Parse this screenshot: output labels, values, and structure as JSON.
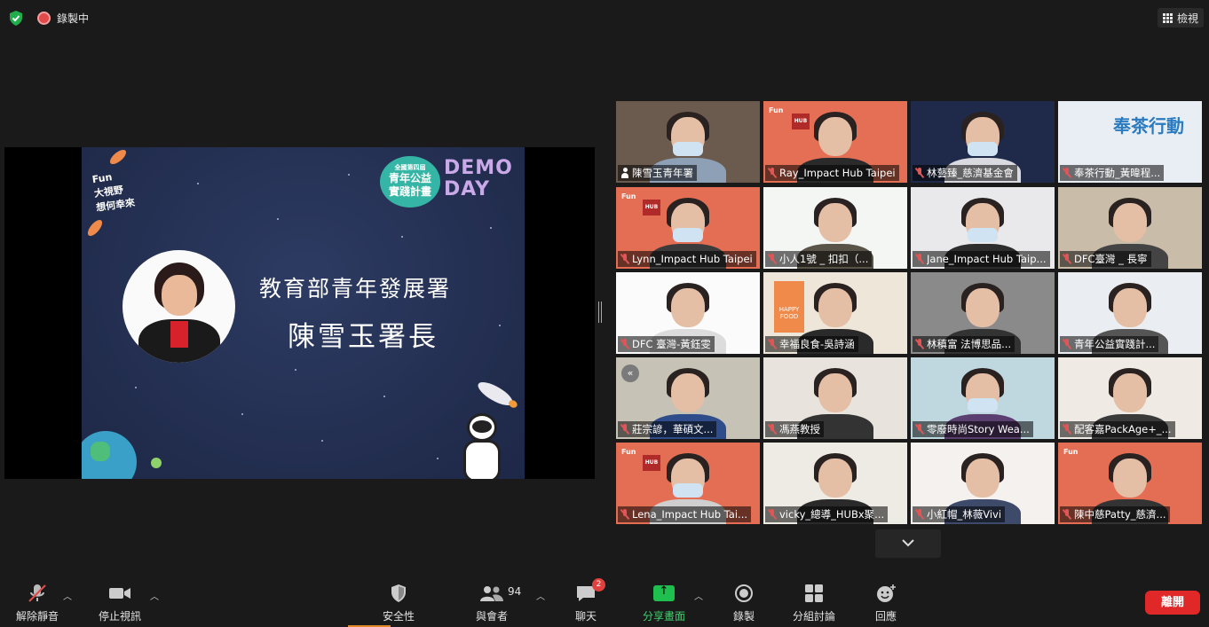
{
  "topbar": {
    "recording_label": "錄製中",
    "view_label": "檢視"
  },
  "colors": {
    "active_speaker_border": "#c8e34b",
    "leave_button": "#e02828",
    "share_green": "#1fbf4f",
    "recording_red": "#e04a4a",
    "security_green": "#1fae4b"
  },
  "shared_screen": {
    "title": "教育部青年發展署",
    "name": "陳雪玉署長",
    "badge_line1": "全國第四屆",
    "badge_line2": "青年公益",
    "badge_line3": "實踐計畫",
    "demo_line1": "DEMO",
    "demo_line2": "DAY",
    "fun_logo_line1": "Fun",
    "fun_logo_line2": "大視野",
    "fun_logo_line3": "想何幸來"
  },
  "participants": [
    {
      "name": "陳雪玉青年署",
      "icon": "pinned-person-icon",
      "active": true
    },
    {
      "name": "Ray_Impact Hub Taipei",
      "icon": "mic-off-icon"
    },
    {
      "name": "林藝臻_慈濟基金會",
      "icon": "mic-off-icon"
    },
    {
      "name": "奉茶行動_黃暐程...",
      "icon": "mic-off-icon"
    },
    {
      "name": "Lynn_Impact Hub Taipei",
      "icon": "mic-off-icon"
    },
    {
      "name": "小人1號 _ 扣扣（...",
      "icon": "mic-off-icon"
    },
    {
      "name": "Jane_Impact Hub Taip...",
      "icon": "mic-off-icon"
    },
    {
      "name": "DFC臺灣 _ 長寧",
      "icon": "mic-off-icon"
    },
    {
      "name": "DFC 臺灣-黃鈺雯",
      "icon": "mic-off-icon"
    },
    {
      "name": "幸福良食-吳詩涵",
      "icon": "mic-off-icon"
    },
    {
      "name": "林稹富 法博思品...",
      "icon": "mic-off-icon"
    },
    {
      "name": "青年公益實踐計...",
      "icon": "mic-off-icon"
    },
    {
      "name": "莊宗諺，華碩文...",
      "icon": "mic-off-icon"
    },
    {
      "name": "馮燕教授",
      "icon": "mic-off-icon"
    },
    {
      "name": "零廢時尚Story Wea...",
      "icon": "mic-off-icon"
    },
    {
      "name": "配客嘉PackAge+_...",
      "icon": "mic-off-icon"
    },
    {
      "name": "Lena_Impact Hub Tai...",
      "icon": "mic-off-icon"
    },
    {
      "name": "vicky_總導_HUBx聚...",
      "icon": "mic-off-icon"
    },
    {
      "name": "小紅帽_林薇Vivi",
      "icon": "mic-off-icon"
    },
    {
      "name": "陳中慈Patty_慈濟...",
      "icon": "mic-off-icon"
    }
  ],
  "tile_texts": {
    "tea_banner": "奉茶行動",
    "hub_logo": "HUB",
    "happy_food": "HAPPY FOOD",
    "back_arrow": "«"
  },
  "toolbar": {
    "unmute_label": "解除靜音",
    "stop_video_label": "停止視訊",
    "security_label": "安全性",
    "participants_label": "與會者",
    "participants_count": "94",
    "chat_label": "聊天",
    "chat_badge": "2",
    "share_label": "分享畫面",
    "record_label": "錄製",
    "breakout_label": "分組討論",
    "reactions_label": "回應",
    "leave_label": "離開"
  }
}
